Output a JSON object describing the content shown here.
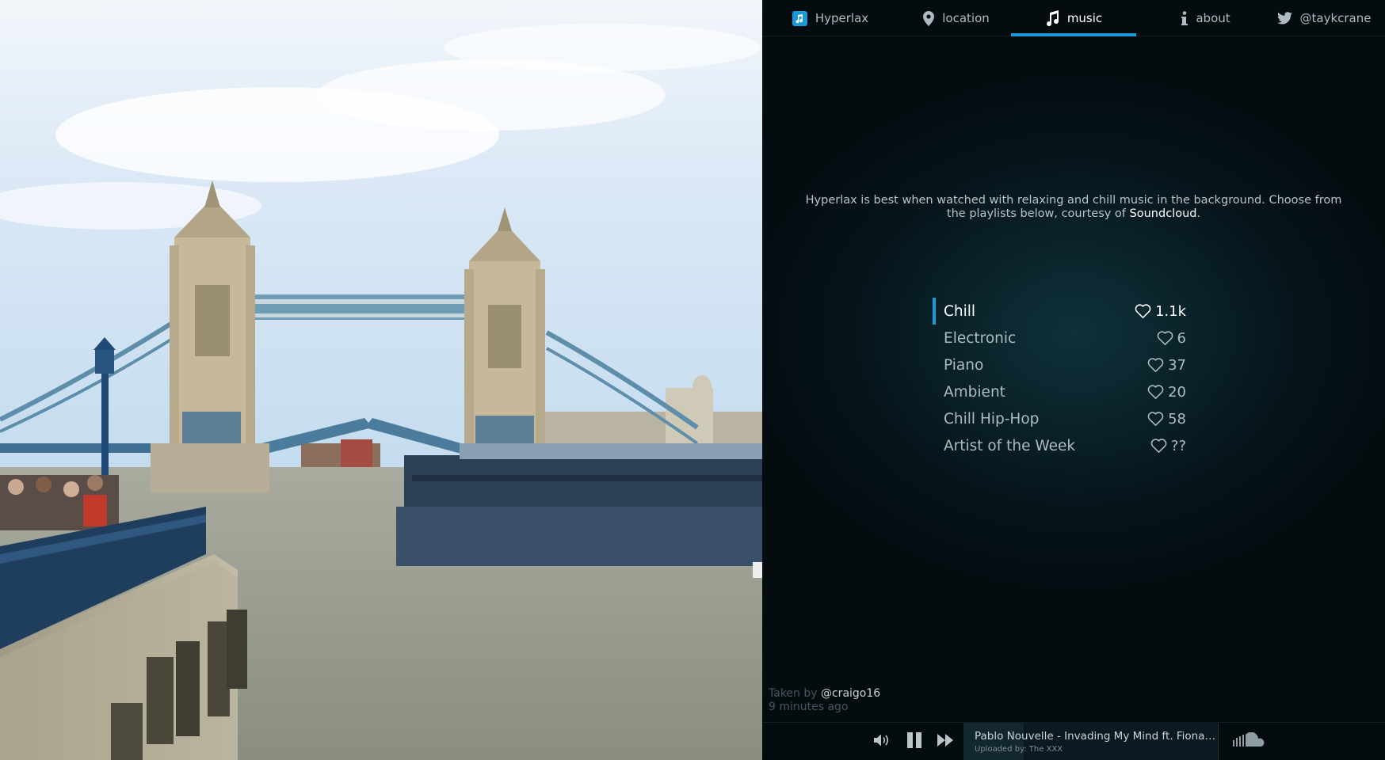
{
  "nav": {
    "items": [
      {
        "label": "Hyperlax",
        "icon": "app-logo-icon",
        "active": false
      },
      {
        "label": "location",
        "icon": "map-pin-icon",
        "active": false
      },
      {
        "label": "music",
        "icon": "music-note-icon",
        "active": true
      },
      {
        "label": "about",
        "icon": "info-icon",
        "active": false
      },
      {
        "label": "@taykcrane",
        "icon": "twitter-icon",
        "active": false
      }
    ]
  },
  "intro": {
    "text": "Hyperlax is best when watched with relaxing and chill music in the background. Choose from the playlists below, courtesy of ",
    "link": "Soundcloud",
    "end": "."
  },
  "playlists": [
    {
      "name": "Chill",
      "likes": "1.1k",
      "active": true
    },
    {
      "name": "Electronic",
      "likes": "6",
      "active": false
    },
    {
      "name": "Piano",
      "likes": "37",
      "active": false
    },
    {
      "name": "Ambient",
      "likes": "20",
      "active": false
    },
    {
      "name": "Chill Hip-Hop",
      "likes": "58",
      "active": false
    },
    {
      "name": "Artist of the Week",
      "likes": "??",
      "active": false
    }
  ],
  "credit": {
    "prefix": "Taken by ",
    "user": "@craigo16",
    "time": "9 minutes ago"
  },
  "player": {
    "track_title": "Pablo Nouvelle - Invading My Mind ft. Fiona Dani...",
    "uploader": "Uploaded by: The XXX",
    "icons": [
      "volume-icon",
      "pause-icon",
      "next-icon",
      "soundcloud-icon"
    ]
  },
  "colors": {
    "accent": "#1a9ad6",
    "panel_bg": "#061319",
    "text": "#c7d3d7"
  }
}
